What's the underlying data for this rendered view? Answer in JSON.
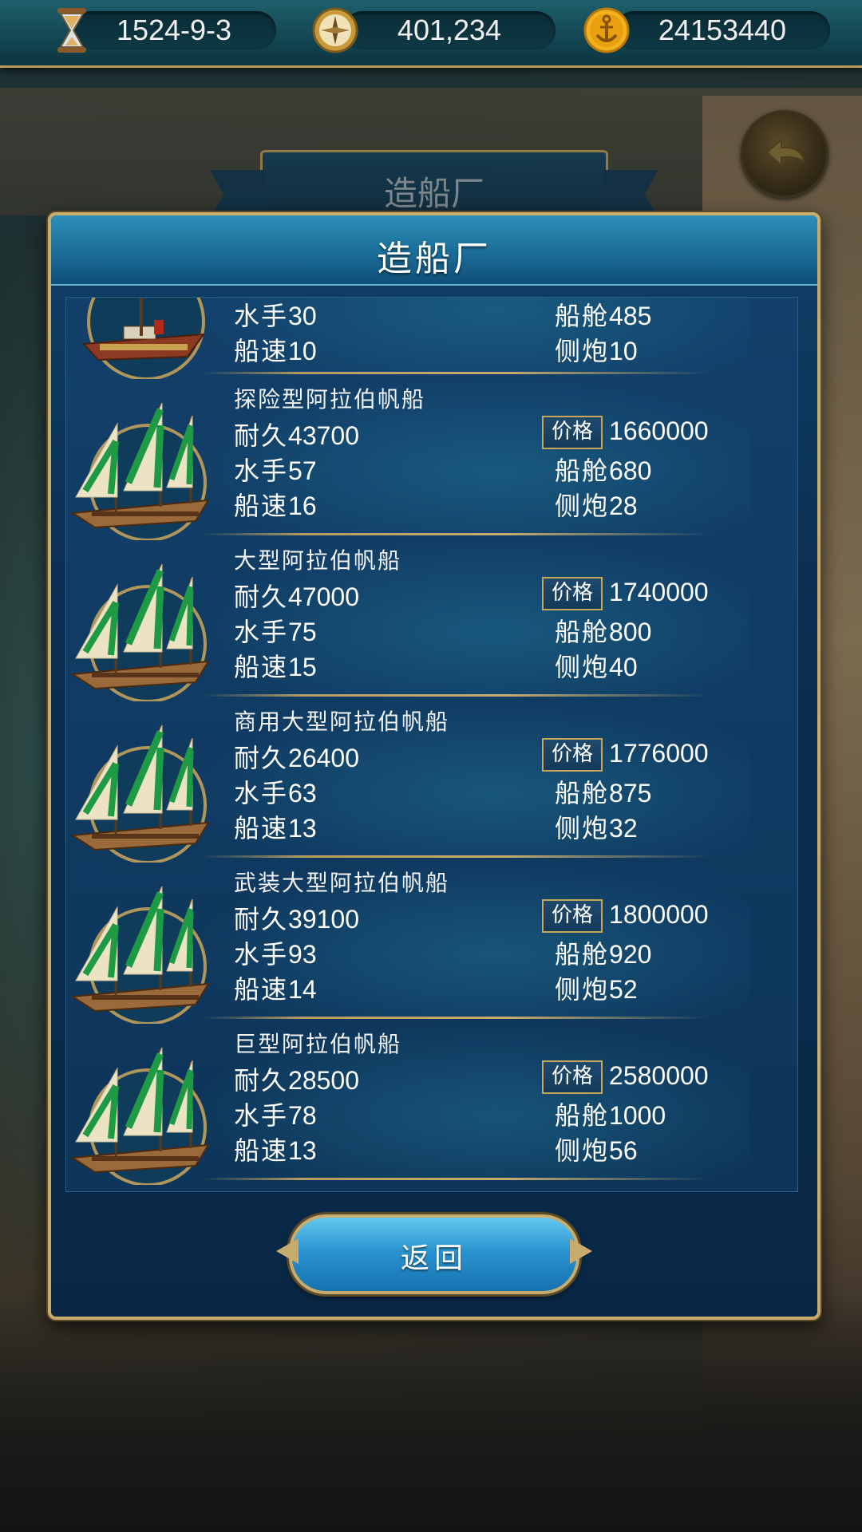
{
  "top_bar": {
    "date": "1524-9-3",
    "compass_value": "401,234",
    "gold": "24153440"
  },
  "background_banner_title": "造船厂",
  "panel": {
    "title": "造船厂",
    "return_label": "返回",
    "price_label": "价格"
  },
  "partial_row": {
    "sailors_label": "水手",
    "sailors": "30",
    "cargo_label": "船舱",
    "cargo": "485",
    "speed_label": "船速",
    "speed": "10",
    "cannons_label": "侧炮",
    "cannons": "10"
  },
  "ships": [
    {
      "name": "探险型阿拉伯帆船",
      "durability_label": "耐久",
      "durability": "43700",
      "price": "1660000",
      "sailors_label": "水手",
      "sailors": "57",
      "cargo_label": "船舱",
      "cargo": "680",
      "speed_label": "船速",
      "speed": "16",
      "cannons_label": "侧炮",
      "cannons": "28"
    },
    {
      "name": "大型阿拉伯帆船",
      "durability_label": "耐久",
      "durability": "47000",
      "price": "1740000",
      "sailors_label": "水手",
      "sailors": "75",
      "cargo_label": "船舱",
      "cargo": "800",
      "speed_label": "船速",
      "speed": "15",
      "cannons_label": "侧炮",
      "cannons": "40"
    },
    {
      "name": "商用大型阿拉伯帆船",
      "durability_label": "耐久",
      "durability": "26400",
      "price": "1776000",
      "sailors_label": "水手",
      "sailors": "63",
      "cargo_label": "船舱",
      "cargo": "875",
      "speed_label": "船速",
      "speed": "13",
      "cannons_label": "侧炮",
      "cannons": "32"
    },
    {
      "name": "武装大型阿拉伯帆船",
      "durability_label": "耐久",
      "durability": "39100",
      "price": "1800000",
      "sailors_label": "水手",
      "sailors": "93",
      "cargo_label": "船舱",
      "cargo": "920",
      "speed_label": "船速",
      "speed": "14",
      "cannons_label": "侧炮",
      "cannons": "52"
    },
    {
      "name": "巨型阿拉伯帆船",
      "durability_label": "耐久",
      "durability": "28500",
      "price": "2580000",
      "sailors_label": "水手",
      "sailors": "78",
      "cargo_label": "船舱",
      "cargo": "1000",
      "speed_label": "船速",
      "speed": "13",
      "cannons_label": "侧炮",
      "cannons": "56"
    }
  ],
  "icons": {
    "date": "hourglass-icon",
    "compass": "compass-icon",
    "gold": "anchor-coin-icon",
    "back": "back-arrow-icon",
    "ship": "sailing-ship-icon"
  },
  "colors": {
    "panel_border": "#c8ac6e",
    "panel_bg": "#0f3f66",
    "sail_green": "#1f9a44",
    "sail_cream": "#ece2c4"
  }
}
